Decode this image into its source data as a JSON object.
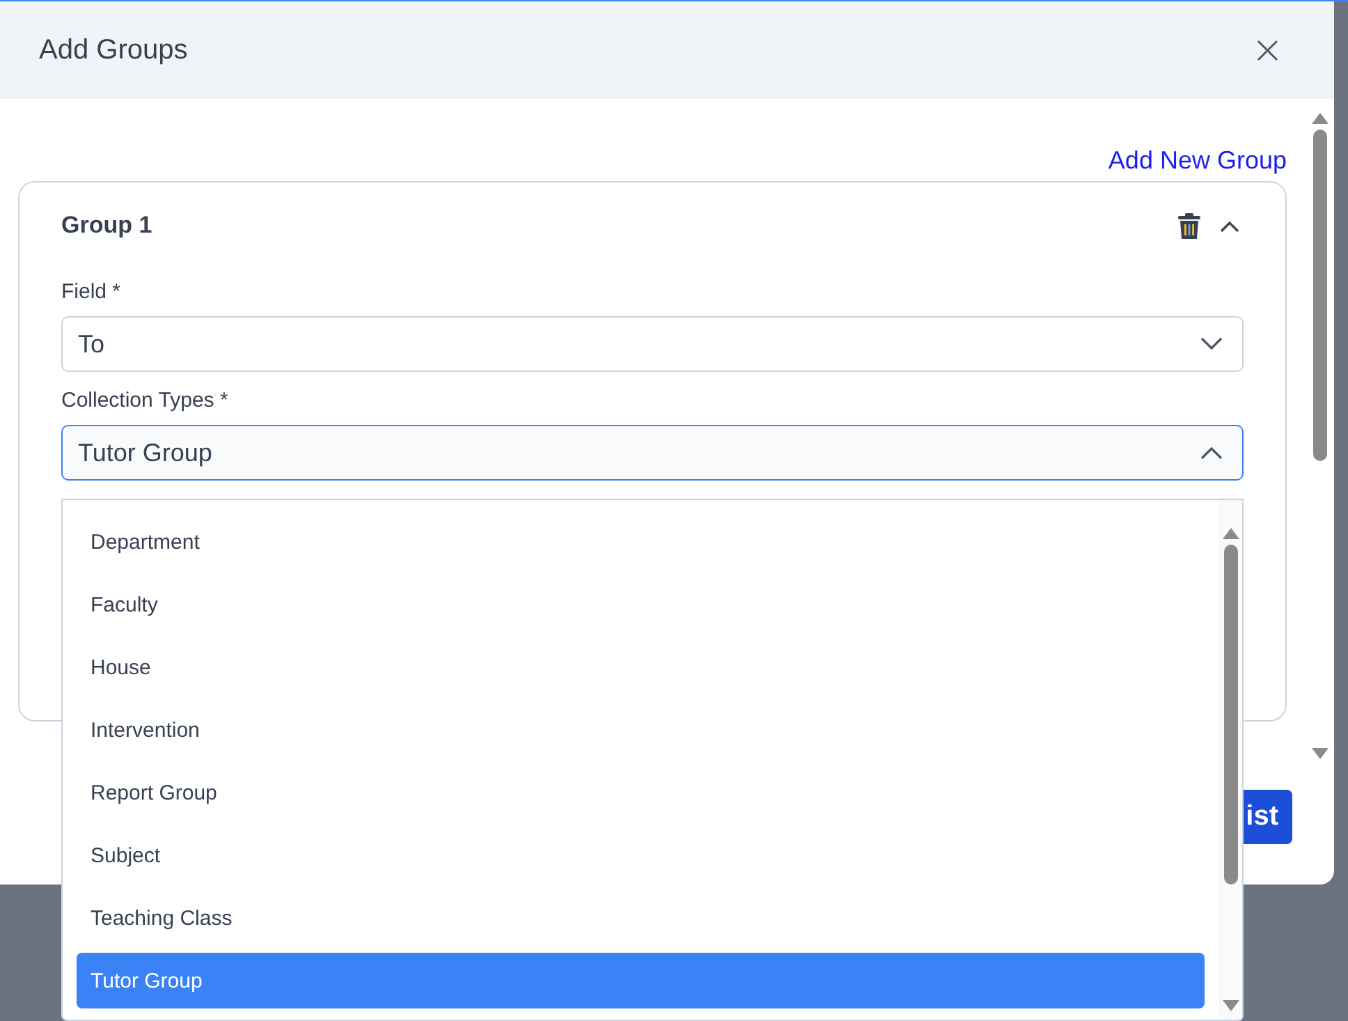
{
  "dialog": {
    "title": "Add Groups",
    "close": "×"
  },
  "add_link": "Add New Group",
  "group": {
    "title": "Group 1",
    "expanded": true,
    "fields": [
      {
        "label": "Field *",
        "value": "To",
        "open": false
      },
      {
        "label": "Collection Types *",
        "value": "Tutor Group",
        "open": true
      }
    ]
  },
  "dropdown": {
    "options": [
      {
        "label": "Department",
        "selected": false
      },
      {
        "label": "Faculty",
        "selected": false
      },
      {
        "label": "House",
        "selected": false
      },
      {
        "label": "Intervention",
        "selected": false
      },
      {
        "label": "Report Group",
        "selected": false
      },
      {
        "label": "Subject",
        "selected": false
      },
      {
        "label": "Teaching Class",
        "selected": false
      },
      {
        "label": "Tutor Group",
        "selected": true
      }
    ]
  },
  "footer_button": "ist"
}
